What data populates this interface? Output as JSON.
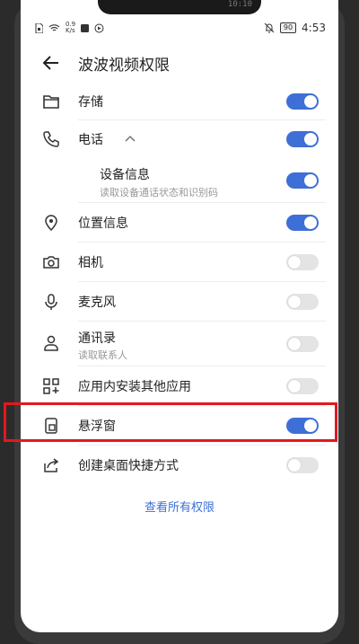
{
  "status": {
    "speed_value": "0.9",
    "speed_unit": "K/s",
    "battery": "90",
    "time": "4:53",
    "top_time": "10:10"
  },
  "header": {
    "title": "波波视频权限"
  },
  "permissions": [
    {
      "label": "存储",
      "icon": "folder-icon",
      "on": true
    },
    {
      "label": "电话",
      "icon": "phone-icon",
      "on": true,
      "chevron": "up"
    },
    {
      "label": "设备信息",
      "sub": "读取设备通话状态和识别码",
      "on": true
    },
    {
      "label": "位置信息",
      "icon": "location-pin-icon",
      "on": true
    },
    {
      "label": "相机",
      "icon": "camera-icon",
      "on": false
    },
    {
      "label": "麦克风",
      "icon": "microphone-icon",
      "on": false
    },
    {
      "label": "通讯录",
      "sub": "读取联系人",
      "icon": "contacts-icon",
      "on": false
    },
    {
      "label": "应用内安装其他应用",
      "icon": "apps-icon",
      "on": false
    },
    {
      "label": "悬浮窗",
      "icon": "floating-window-icon",
      "on": true
    },
    {
      "label": "创建桌面快捷方式",
      "icon": "shortcut-icon",
      "on": false
    }
  ],
  "footer": {
    "link": "查看所有权限"
  },
  "colors": {
    "accent": "#3e6fd6",
    "highlight": "#e3181f"
  }
}
